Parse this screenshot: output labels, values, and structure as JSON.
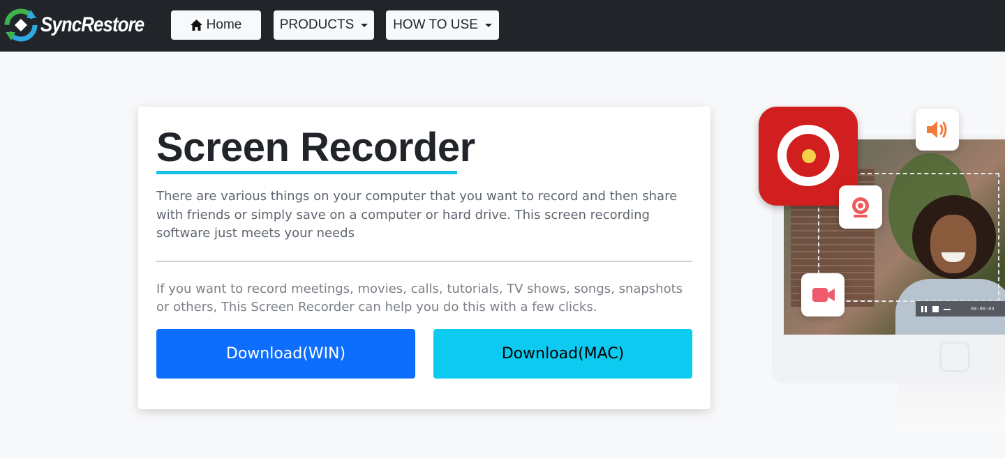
{
  "brand": {
    "name": "SyncRestore"
  },
  "nav": {
    "home": "Home",
    "products": "PRODUCTS",
    "how_to_use": "HOW TO USE"
  },
  "hero_card": {
    "title": "Screen Recorder",
    "description": "There are various things on your computer that you want to record and then share with friends or simply save on a computer or hard drive. This screen recording software just meets your needs",
    "description2": "If you want to record meetings, movies, calls, tutorials, TV shows, songs, snapshots or others, This Screen Recorder can help you do this with a few clicks.",
    "download_win": "Download(WIN)",
    "download_mac": "Download(MAC)"
  },
  "illustration": {
    "player_time": "00:00:03",
    "icons": [
      "screen-recorder-app-icon",
      "speaker-icon",
      "webcam-icon",
      "video-camera-icon"
    ]
  },
  "colors": {
    "navbar": "#212529",
    "accent_underline": "#17c1e8",
    "win_button": "#0d6efd",
    "mac_button": "#0dcaf0",
    "app_icon_red": "#d11f1f"
  }
}
